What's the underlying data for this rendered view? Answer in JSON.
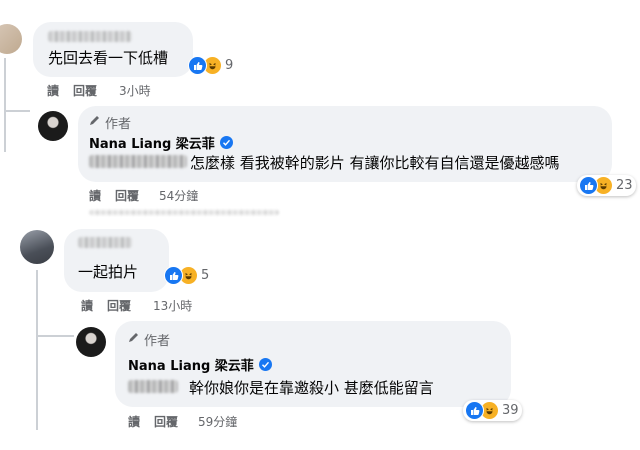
{
  "comments": [
    {
      "text": "先回去看一下低槽",
      "reactions": "9"
    },
    {
      "author_badge": "作者",
      "author_name": "Nana Liang 梁云菲",
      "text": "怎麼樣 看我被幹的影片 有讓你比較有自信還是優越感嗎",
      "reactions": "23"
    },
    {
      "text": "一起拍片",
      "reactions": "5"
    },
    {
      "author_badge": "作者",
      "author_name": "Nana Liang 梁云菲",
      "text": "幹你娘你是在靠邀殺小 甚麼低能留言",
      "reactions": "39"
    }
  ],
  "actions": [
    {
      "read": "讀",
      "reply": "回覆",
      "time": "3小時"
    },
    {
      "read": "讀",
      "reply": "回覆",
      "time": "54分鐘"
    },
    {
      "read": "讀",
      "reply": "回覆",
      "time": "13小時"
    },
    {
      "read": "讀",
      "reply": "回覆",
      "time": "59分鐘"
    }
  ],
  "icons": {
    "like": "like-reaction-icon",
    "haha": "haha-reaction-icon",
    "pencil": "pencil-icon",
    "verified": "verified-badge-icon"
  },
  "colors": {
    "bubble": "#f0f2f5",
    "secondary_text": "#65676b",
    "like_blue": "#1877f2",
    "haha_yellow": "#f7b125"
  }
}
